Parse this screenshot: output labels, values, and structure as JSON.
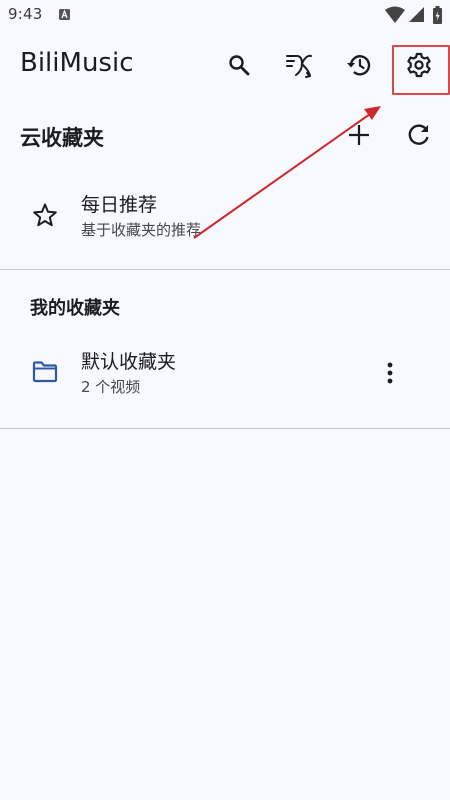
{
  "status_bar": {
    "time": "9:43"
  },
  "app_bar": {
    "title": "BiliMusic",
    "actions": [
      "search-icon",
      "shuffle-icon",
      "history-icon",
      "settings-icon"
    ]
  },
  "cloud_section": {
    "title": "云收藏夹",
    "items": [
      {
        "title": "每日推荐",
        "subtitle": "基于收藏夹的推荐",
        "icon": "star-outline-icon"
      }
    ]
  },
  "my_section": {
    "title": "我的收藏夹",
    "items": [
      {
        "title": "默认收藏夹",
        "subtitle": "2 个视频",
        "icon": "folder-outline-icon"
      }
    ]
  },
  "colors": {
    "background": "#f8f9ff",
    "text": "#1b1c20",
    "icon_accent": "#2d5aa0",
    "annotation": "#d02828"
  }
}
